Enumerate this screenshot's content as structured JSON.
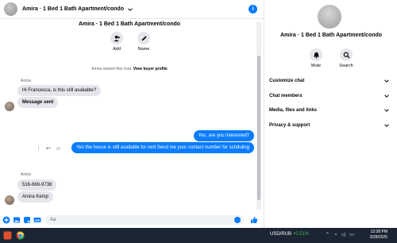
{
  "header": {
    "title": "Amira · 1 Bed 1 Bath Apartment/condo",
    "info_icon": "info-icon"
  },
  "conversation": {
    "title": "Amira · 1 Bed 1 Bath Apartment/condo",
    "actions": [
      {
        "label": "Add",
        "icon": "add-person-icon"
      },
      {
        "label": "Name",
        "icon": "pencil-icon"
      }
    ],
    "system_text": "Amira started this chat.",
    "system_link": "View buyer profile"
  },
  "messages": {
    "group1_sender": "Amira",
    "in1": "Hi Francesca, is this still available?",
    "in2": "Message sent",
    "out1": "Yes, are you interested?",
    "out2": "Yes the house is still available for rent Send me your contact number for schduling",
    "group2_sender": "Amira",
    "in3": "516-669-9738",
    "in4": "Amira Kemp"
  },
  "composer": {
    "placeholder": "Aa",
    "icons": [
      "plus-icon",
      "gallery-icon",
      "sticker-icon",
      "gif-icon",
      "emoji-icon",
      "like-icon"
    ]
  },
  "sidebar": {
    "title": "Amira · 1 Bed 1 Bath Apartment/condo",
    "actions": [
      {
        "label": "Mute",
        "icon": "bell-icon"
      },
      {
        "label": "Search",
        "icon": "search-icon"
      }
    ],
    "sections": [
      {
        "label": "Customize chat"
      },
      {
        "label": "Chat members"
      },
      {
        "label": "Media, files and links"
      },
      {
        "label": "Privacy & support"
      }
    ]
  },
  "taskbar": {
    "ticker_symbol": "USD/RUB",
    "ticker_change": "+0.51%",
    "time": "12:38 PM",
    "date": "3/28/2025"
  },
  "colors": {
    "accent": "#0a7cff",
    "bubble_in": "#e4e6eb",
    "taskbar": "#1c2533"
  }
}
